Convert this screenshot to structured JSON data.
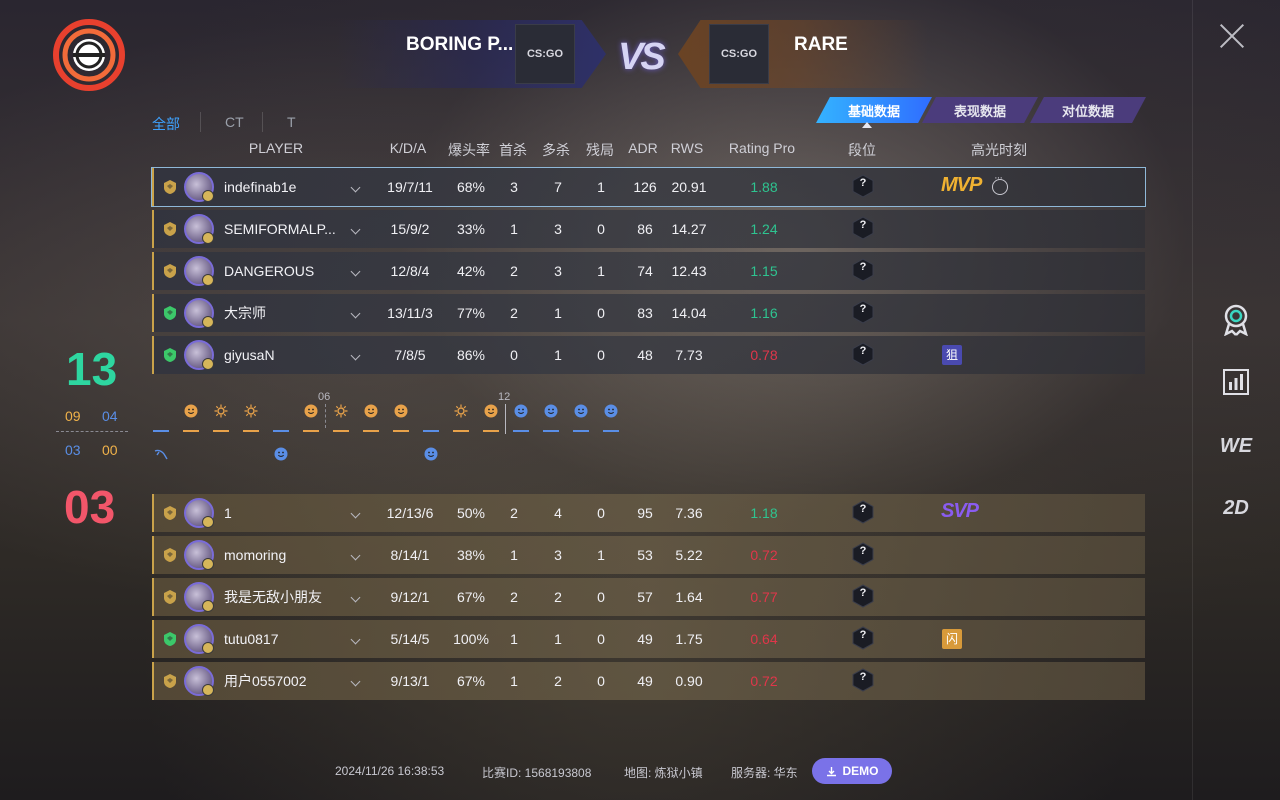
{
  "header": {
    "team_left": "BORING P...",
    "team_right": "RARE",
    "vs": "VS",
    "team_logo_text": "CS:GO"
  },
  "filters": {
    "sides": [
      "全部",
      "CT",
      "T"
    ],
    "active_side": "全部"
  },
  "data_tabs": [
    {
      "label": "基础数据",
      "active": true
    },
    {
      "label": "表现数据",
      "active": false
    },
    {
      "label": "对位数据",
      "active": false
    }
  ],
  "columns": {
    "player": "PLAYER",
    "kda": "K/D/A",
    "hs": "爆头率",
    "first_kill": "首杀",
    "multi_kill": "多杀",
    "clutch": "残局",
    "adr": "ADR",
    "rws": "RWS",
    "rating": "Rating Pro",
    "rank": "段位",
    "highlight": "高光时刻"
  },
  "score": {
    "team_top": "13",
    "team_bottom": "03",
    "top_half1": "09",
    "top_half2": "04",
    "bottom_half1": "03",
    "bottom_half2": "00"
  },
  "team_top_players": [
    {
      "name": "indefinab1e",
      "kda": "19/7/11",
      "hs": "68%",
      "fk": "3",
      "mk": "7",
      "cl": "1",
      "adr": "126",
      "rws": "20.91",
      "rating": "1.88",
      "rating_good": true,
      "rank": "?",
      "badge": "MVP",
      "rank_icon_color": "#c9a24a"
    },
    {
      "name": "SEMIFORMALP...",
      "kda": "15/9/2",
      "hs": "33%",
      "fk": "1",
      "mk": "3",
      "cl": "0",
      "adr": "86",
      "rws": "14.27",
      "rating": "1.24",
      "rating_good": true,
      "rank": "?",
      "badge": "",
      "rank_icon_color": "#c9a24a"
    },
    {
      "name": "DANGEROUS",
      "kda": "12/8/4",
      "hs": "42%",
      "fk": "2",
      "mk": "3",
      "cl": "1",
      "adr": "74",
      "rws": "12.43",
      "rating": "1.15",
      "rating_good": true,
      "rank": "?",
      "badge": "",
      "rank_icon_color": "#c9a24a"
    },
    {
      "name": "大宗师",
      "kda": "13/11/3",
      "hs": "77%",
      "fk": "2",
      "mk": "1",
      "cl": "0",
      "adr": "83",
      "rws": "14.04",
      "rating": "1.16",
      "rating_good": true,
      "rank": "?",
      "badge": "",
      "rank_icon_color": "#3cc86a"
    },
    {
      "name": "giyusaN",
      "kda": "7/8/5",
      "hs": "86%",
      "fk": "0",
      "mk": "1",
      "cl": "0",
      "adr": "48",
      "rws": "7.73",
      "rating": "0.78",
      "rating_good": false,
      "rank": "?",
      "badge": "狙",
      "rank_icon_color": "#3cc86a"
    }
  ],
  "team_bottom_players": [
    {
      "name": "1",
      "kda": "12/13/6",
      "hs": "50%",
      "fk": "2",
      "mk": "4",
      "cl": "0",
      "adr": "95",
      "rws": "7.36",
      "rating": "1.18",
      "rating_good": true,
      "rank": "?",
      "badge": "SVP",
      "rank_icon_color": "#c9a24a"
    },
    {
      "name": "momoring",
      "kda": "8/14/1",
      "hs": "38%",
      "fk": "1",
      "mk": "3",
      "cl": "1",
      "adr": "53",
      "rws": "5.22",
      "rating": "0.72",
      "rating_good": false,
      "rank": "?",
      "badge": "",
      "rank_icon_color": "#c9a24a"
    },
    {
      "name": "我是无敌小朋友",
      "kda": "9/12/1",
      "hs": "67%",
      "fk": "2",
      "mk": "2",
      "cl": "0",
      "adr": "57",
      "rws": "1.64",
      "rating": "0.77",
      "rating_good": false,
      "rank": "?",
      "badge": "",
      "rank_icon_color": "#c9a24a"
    },
    {
      "name": "tutu0817",
      "kda": "5/14/5",
      "hs": "100%",
      "fk": "1",
      "mk": "1",
      "cl": "0",
      "adr": "49",
      "rws": "1.75",
      "rating": "0.64",
      "rating_good": false,
      "rank": "?",
      "badge": "闪",
      "rank_icon_color": "#3cc86a"
    },
    {
      "name": "用户0557002",
      "kda": "9/13/1",
      "hs": "67%",
      "fk": "1",
      "mk": "2",
      "cl": "0",
      "adr": "49",
      "rws": "0.90",
      "rating": "0.72",
      "rating_good": false,
      "rank": "?",
      "badge": "",
      "rank_icon_color": "#c9a24a"
    }
  ],
  "timeline": {
    "marker_06": "06",
    "marker_12": "12"
  },
  "footer": {
    "date": "2024/11/26 16:38:53",
    "match_id": "比赛ID: 1568193808",
    "map": "地图: 炼狱小镇",
    "server": "服务器: 华东",
    "demo": "DEMO"
  },
  "rail": {
    "we": "WE",
    "twod": "2D"
  },
  "colors": {
    "accent": "#3ea2ff",
    "ct_score": "#2ed6a0",
    "t_score": "#f2566a",
    "rating_good": "#2ec490",
    "rating_bad": "#e0364a",
    "mvp": "#f0b232",
    "svp": "#8a5cf0"
  }
}
